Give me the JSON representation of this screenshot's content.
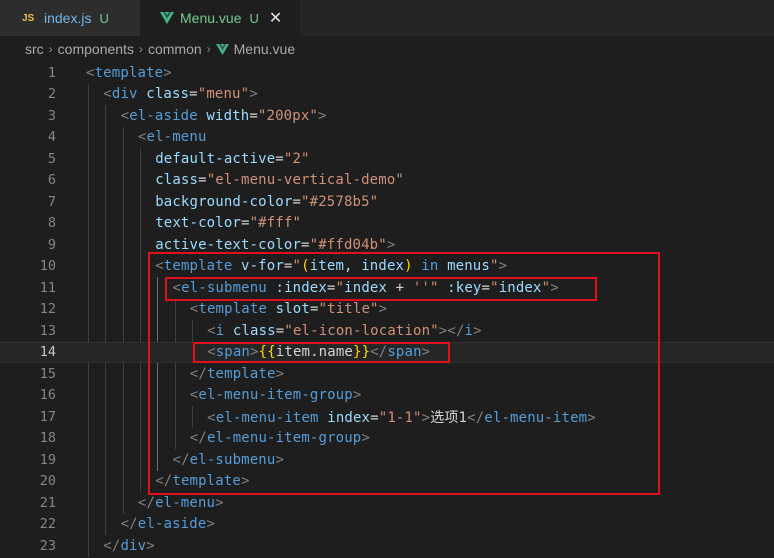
{
  "tabs": [
    {
      "badge": "JS",
      "name": "index.js",
      "status": "U"
    },
    {
      "name": "Menu.vue",
      "status": "U",
      "close": "✕"
    }
  ],
  "breadcrumb": {
    "parts": [
      "src",
      "components",
      "common",
      "Menu.vue"
    ],
    "separator": "›"
  },
  "colors": {
    "editor_bg": "#1e1e1e",
    "highlight_box": "#e0101e",
    "vue_green": "#42b883",
    "git_untracked": "#73c991"
  },
  "editor": {
    "current_line": 14,
    "lines": [
      {
        "n": "1",
        "tokens": [
          [
            "tk-bracket",
            "<"
          ],
          [
            "tk-tag",
            "template"
          ],
          [
            "tk-bracket",
            ">"
          ]
        ]
      },
      {
        "n": "2",
        "tokens": [
          [
            "tk-bracket",
            "<"
          ],
          [
            "tk-tag",
            "div"
          ],
          [
            "tk-text",
            " "
          ],
          [
            "tk-attr",
            "class"
          ],
          [
            "tk-eq",
            "="
          ],
          [
            "tk-str",
            "\"menu\""
          ],
          [
            "tk-bracket",
            ">"
          ]
        ]
      },
      {
        "n": "3",
        "tokens": [
          [
            "tk-bracket",
            "<"
          ],
          [
            "tk-tag",
            "el-aside"
          ],
          [
            "tk-text",
            " "
          ],
          [
            "tk-attr",
            "width"
          ],
          [
            "tk-eq",
            "="
          ],
          [
            "tk-str",
            "\"200px\""
          ],
          [
            "tk-bracket",
            ">"
          ]
        ]
      },
      {
        "n": "4",
        "tokens": [
          [
            "tk-bracket",
            "<"
          ],
          [
            "tk-tag",
            "el-menu"
          ]
        ]
      },
      {
        "n": "5",
        "tokens": [
          [
            "tk-attr",
            "default-active"
          ],
          [
            "tk-eq",
            "="
          ],
          [
            "tk-str",
            "\"2\""
          ]
        ]
      },
      {
        "n": "6",
        "tokens": [
          [
            "tk-attr",
            "class"
          ],
          [
            "tk-eq",
            "="
          ],
          [
            "tk-str",
            "\"el-menu-vertical-demo\""
          ]
        ]
      },
      {
        "n": "7",
        "tokens": [
          [
            "tk-attr",
            "background-color"
          ],
          [
            "tk-eq",
            "="
          ],
          [
            "tk-str",
            "\"#2578b5\""
          ]
        ]
      },
      {
        "n": "8",
        "tokens": [
          [
            "tk-attr",
            "text-color"
          ],
          [
            "tk-eq",
            "="
          ],
          [
            "tk-str",
            "\"#fff\""
          ]
        ]
      },
      {
        "n": "9",
        "tokens": [
          [
            "tk-attr",
            "active-text-color"
          ],
          [
            "tk-eq",
            "="
          ],
          [
            "tk-str",
            "\"#ffd04b\""
          ],
          [
            "tk-bracket",
            ">"
          ]
        ]
      },
      {
        "n": "10",
        "tokens": [
          [
            "tk-bracket",
            "<"
          ],
          [
            "tk-tag",
            "template"
          ],
          [
            "tk-text",
            " "
          ],
          [
            "tk-attr",
            "v-for"
          ],
          [
            "tk-eq",
            "="
          ],
          [
            "tk-str",
            "\""
          ],
          [
            "tk-vfor-paren",
            "("
          ],
          [
            "tk-attr",
            "item"
          ],
          [
            "tk-text",
            ", "
          ],
          [
            "tk-attr",
            "index"
          ],
          [
            "tk-vfor-paren",
            ")"
          ],
          [
            "tk-text",
            " "
          ],
          [
            "tk-kw",
            "in"
          ],
          [
            "tk-text",
            " "
          ],
          [
            "tk-attr",
            "menus"
          ],
          [
            "tk-str",
            "\""
          ],
          [
            "tk-bracket",
            ">"
          ]
        ]
      },
      {
        "n": "11",
        "tokens": [
          [
            "tk-bracket",
            "<"
          ],
          [
            "tk-tag",
            "el-submenu"
          ],
          [
            "tk-text",
            " "
          ],
          [
            "tk-attr",
            ":index"
          ],
          [
            "tk-eq",
            "="
          ],
          [
            "tk-str",
            "\""
          ],
          [
            "tk-attr",
            "index"
          ],
          [
            "tk-text",
            " + "
          ],
          [
            "tk-str",
            "''"
          ],
          [
            "tk-str",
            "\""
          ],
          [
            "tk-text",
            " "
          ],
          [
            "tk-attr",
            ":key"
          ],
          [
            "tk-eq",
            "="
          ],
          [
            "tk-str",
            "\""
          ],
          [
            "tk-attr",
            "index"
          ],
          [
            "tk-str",
            "\""
          ],
          [
            "tk-bracket",
            ">"
          ]
        ]
      },
      {
        "n": "12",
        "tokens": [
          [
            "tk-bracket",
            "<"
          ],
          [
            "tk-tag",
            "template"
          ],
          [
            "tk-text",
            " "
          ],
          [
            "tk-attr",
            "slot"
          ],
          [
            "tk-eq",
            "="
          ],
          [
            "tk-str",
            "\"title\""
          ],
          [
            "tk-bracket",
            ">"
          ]
        ]
      },
      {
        "n": "13",
        "tokens": [
          [
            "tk-bracket",
            "<"
          ],
          [
            "tk-tag",
            "i"
          ],
          [
            "tk-text",
            " "
          ],
          [
            "tk-attr",
            "class"
          ],
          [
            "tk-eq",
            "="
          ],
          [
            "tk-str",
            "\"el-icon-location\""
          ],
          [
            "tk-bracket",
            "></"
          ],
          [
            "tk-tag",
            "i"
          ],
          [
            "tk-bracket",
            ">"
          ]
        ]
      },
      {
        "n": "14",
        "tokens": [
          [
            "tk-bracket",
            "<"
          ],
          [
            "tk-tag",
            "span"
          ],
          [
            "tk-bracket",
            ">"
          ],
          [
            "tk-mus",
            "{{"
          ],
          [
            "tk-text",
            "item.name"
          ],
          [
            "tk-mus",
            "}}"
          ],
          [
            "tk-bracket",
            "</"
          ],
          [
            "tk-tag",
            "span"
          ],
          [
            "tk-bracket",
            ">"
          ]
        ]
      },
      {
        "n": "15",
        "tokens": [
          [
            "tk-bracket",
            "</"
          ],
          [
            "tk-tag",
            "template"
          ],
          [
            "tk-bracket",
            ">"
          ]
        ]
      },
      {
        "n": "16",
        "tokens": [
          [
            "tk-bracket",
            "<"
          ],
          [
            "tk-tag",
            "el-menu-item-group"
          ],
          [
            "tk-bracket",
            ">"
          ]
        ]
      },
      {
        "n": "17",
        "tokens": [
          [
            "tk-bracket",
            "<"
          ],
          [
            "tk-tag",
            "el-menu-item"
          ],
          [
            "tk-text",
            " "
          ],
          [
            "tk-attr",
            "index"
          ],
          [
            "tk-eq",
            "="
          ],
          [
            "tk-str",
            "\"1-1\""
          ],
          [
            "tk-bracket",
            ">"
          ],
          [
            "tk-text",
            "选项1"
          ],
          [
            "tk-bracket",
            "</"
          ],
          [
            "tk-tag",
            "el-menu-item"
          ],
          [
            "tk-bracket",
            ">"
          ]
        ]
      },
      {
        "n": "18",
        "tokens": [
          [
            "tk-bracket",
            "</"
          ],
          [
            "tk-tag",
            "el-menu-item-group"
          ],
          [
            "tk-bracket",
            ">"
          ]
        ]
      },
      {
        "n": "19",
        "tokens": [
          [
            "tk-bracket",
            "</"
          ],
          [
            "tk-tag",
            "el-submenu"
          ],
          [
            "tk-bracket",
            ">"
          ]
        ]
      },
      {
        "n": "20",
        "tokens": [
          [
            "tk-bracket",
            "</"
          ],
          [
            "tk-tag",
            "template"
          ],
          [
            "tk-bracket",
            ">"
          ]
        ]
      },
      {
        "n": "21",
        "tokens": [
          [
            "tk-bracket",
            "</"
          ],
          [
            "tk-tag",
            "el-menu"
          ],
          [
            "tk-bracket",
            ">"
          ]
        ]
      },
      {
        "n": "22",
        "tokens": [
          [
            "tk-bracket",
            "</"
          ],
          [
            "tk-tag",
            "el-aside"
          ],
          [
            "tk-bracket",
            ">"
          ]
        ]
      },
      {
        "n": "23",
        "tokens": [
          [
            "tk-bracket",
            "</"
          ],
          [
            "tk-tag",
            "div"
          ],
          [
            "tk-bracket",
            ">"
          ]
        ]
      }
    ]
  }
}
